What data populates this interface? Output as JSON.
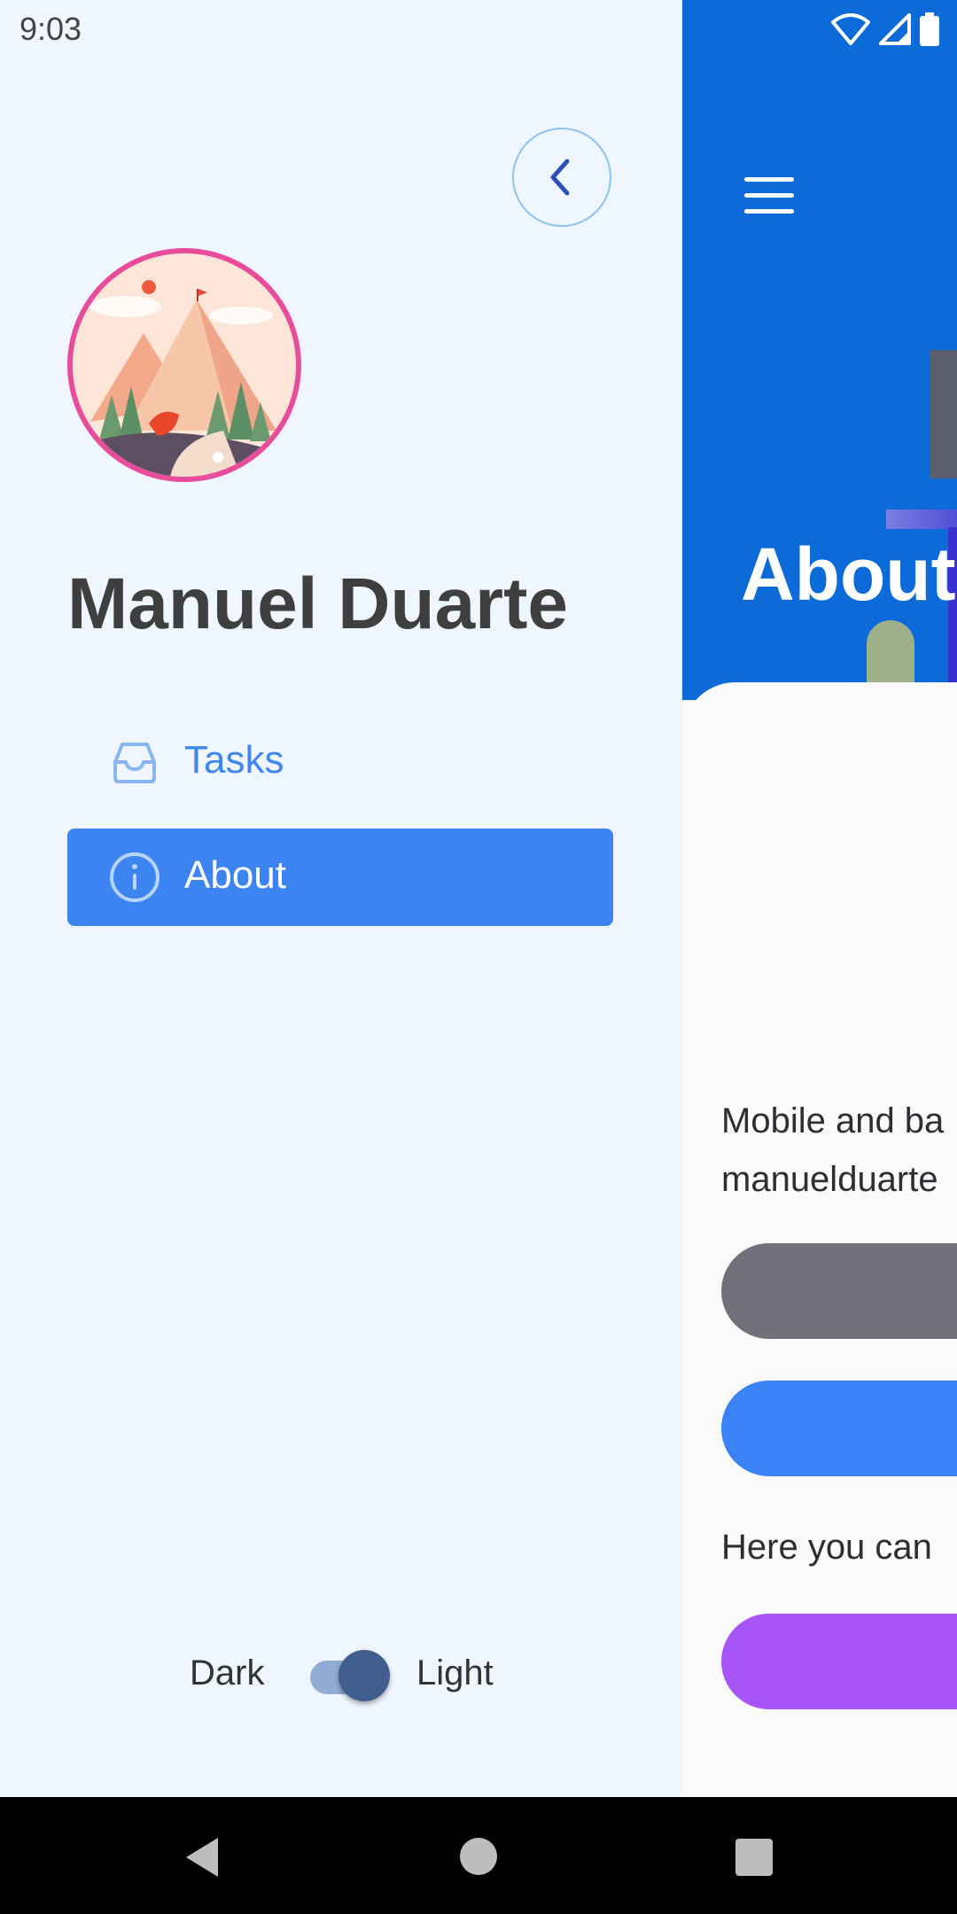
{
  "status_bar": {
    "time": "9:03"
  },
  "drawer": {
    "profile_name": "Manuel Duarte",
    "nav_items": [
      {
        "label": "Tasks",
        "icon": "inbox-icon",
        "active": false
      },
      {
        "label": "About",
        "icon": "info-icon",
        "active": true
      }
    ],
    "theme": {
      "dark_label": "Dark",
      "light_label": "Light",
      "mode": "light"
    }
  },
  "main": {
    "title": "About",
    "text_line_1": "Mobile and ba",
    "text_line_2": "manuelduarte",
    "text_line_3": "Here you can"
  },
  "colors": {
    "accent": "#3c84f2",
    "header_blue": "#0c6ad9",
    "drawer_bg": "#f0f6ff",
    "button_gray": "#71717a",
    "button_blue": "#3b82f6",
    "button_purple": "#a855f7",
    "avatar_border": "#e84d9b"
  }
}
